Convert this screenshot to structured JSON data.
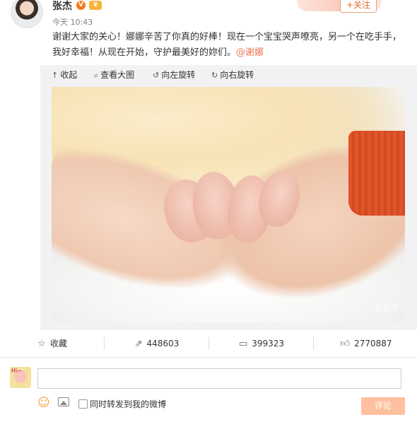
{
  "post": {
    "username": "张杰",
    "verified_icon": "v-badge-icon",
    "member_icon": "crown-icon",
    "follow_label": "+关注",
    "timestamp": "今天 10:43",
    "text": "谢谢大家的关心！娜娜辛苦了你真的好棒！现在一个宝宝哭声嘹亮，另一个在吃手手，我好幸福！从现在开始，守护最美好的妳们。",
    "mention": "@谢娜"
  },
  "media_toolbar": {
    "collapse": "收起",
    "view_large": "查看大图",
    "rotate_left": "向左旋转",
    "rotate_right": "向右旋转"
  },
  "photo": {
    "watermark": "@张杰"
  },
  "actions": {
    "favorite": "收藏",
    "repost_count": "448603",
    "comment_count": "399323",
    "like_count": "2770887"
  },
  "comment_box": {
    "input_value": "",
    "repost_option_label": "同时转发到我的微博",
    "submit_label": "评论"
  },
  "colors": {
    "mention": "#eb7350",
    "submit_button": "#ffc09f",
    "follow_border": "#e8a27f"
  }
}
